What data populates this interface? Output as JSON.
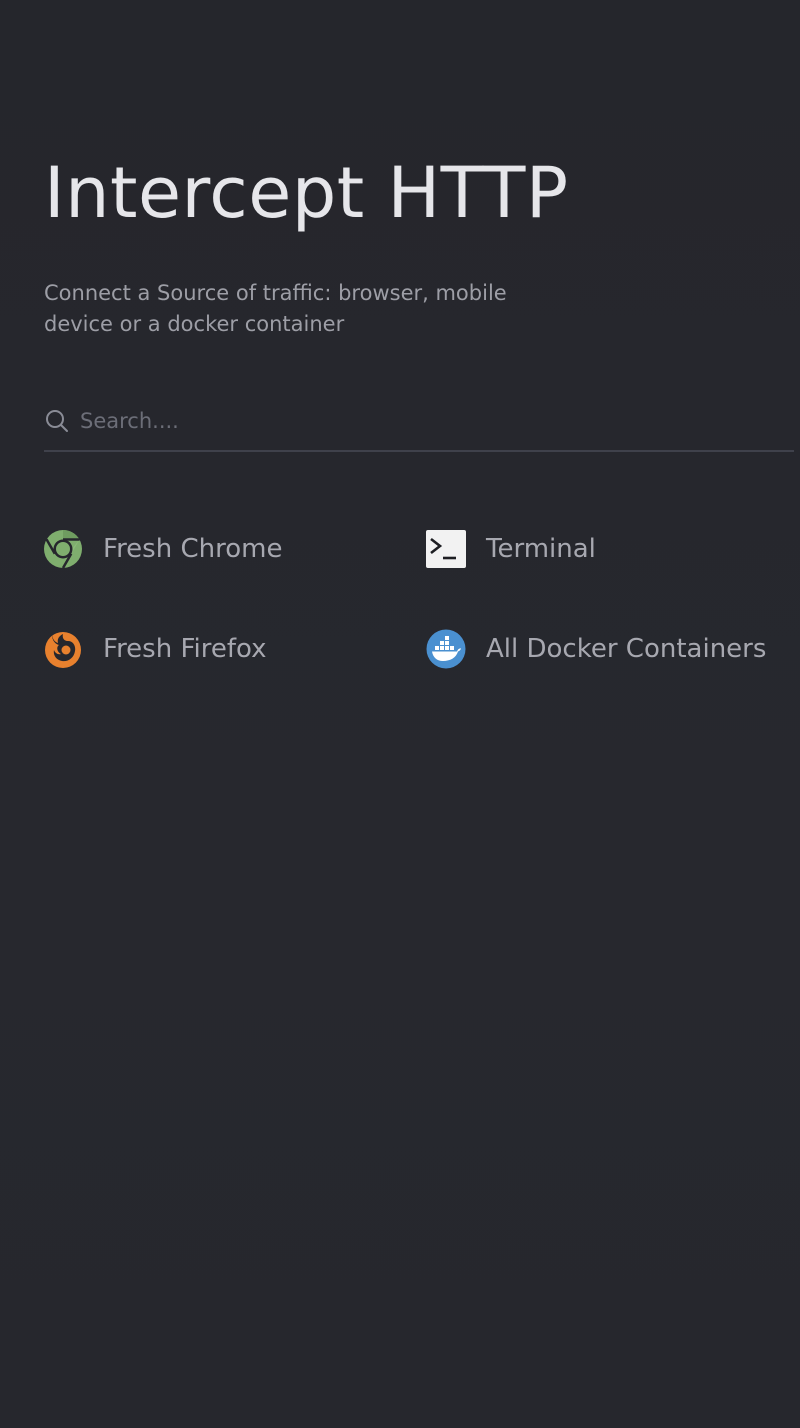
{
  "header": {
    "title": "Intercept HTTP",
    "subtitle": "Connect a Source of traffic: browser, mobile device or a docker container"
  },
  "search": {
    "placeholder": "Search....",
    "value": ""
  },
  "sources": [
    {
      "label": "Fresh Chrome",
      "icon": "chrome-icon"
    },
    {
      "label": "Terminal",
      "icon": "terminal-icon"
    },
    {
      "label": "Fresh Firefox",
      "icon": "firefox-icon"
    },
    {
      "label": "All Docker Containers",
      "icon": "docker-icon"
    }
  ],
  "colors": {
    "background": "#26272d",
    "title": "#e6e6ea",
    "chrome": "#7fae6e",
    "firefox": "#e8812e",
    "docker": "#4a90d0",
    "terminal_bg": "#f2f2f2"
  }
}
